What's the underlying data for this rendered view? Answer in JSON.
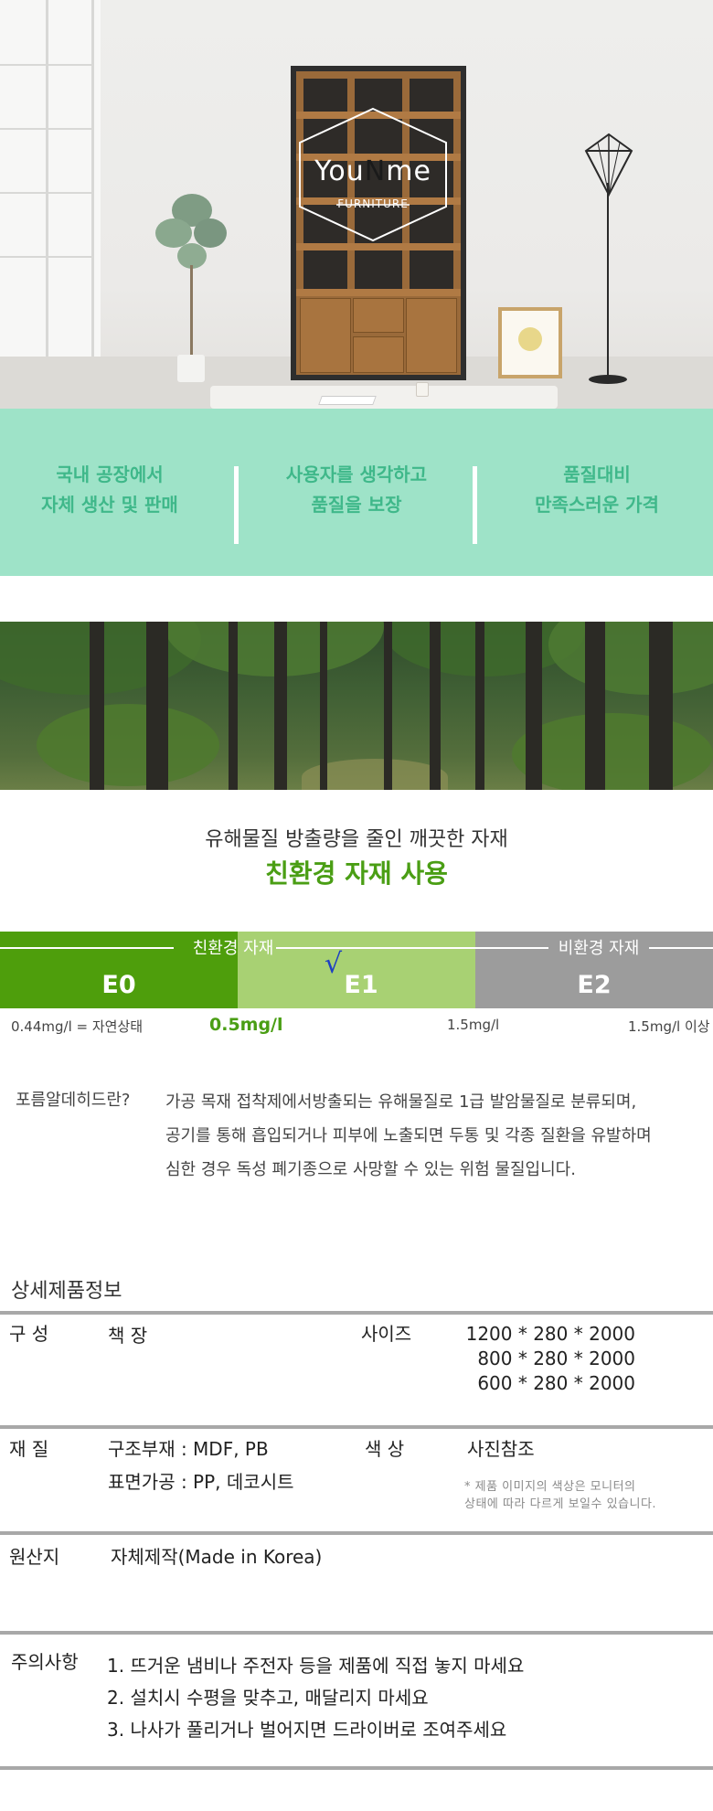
{
  "hero": {
    "brand_pre": "You",
    "brand_n": "N",
    "brand_post": "me",
    "brand_sub": "FURNITURE"
  },
  "features": [
    {
      "line1": "국내 공장에서",
      "line2": "자체 생산 및 판매"
    },
    {
      "line1": "사용자를 생각하고",
      "line2": "품질을 보장"
    },
    {
      "line1": "품질대비",
      "line2": "만족스러운 가격"
    }
  ],
  "eco": {
    "subtitle": "유해물질 방출량을 줄인 깨끗한 자재",
    "title": "친환경 자재 사용",
    "group_eco": "친환경 자재",
    "group_non_eco": "비환경 자재",
    "levels": [
      "E0",
      "E1",
      "E2"
    ],
    "selected_level": "E1",
    "check_mark": "√",
    "values": {
      "e0": "0.44mg/l = 자연상태",
      "e1": "0.5mg/l",
      "e2": "1.5mg/l",
      "e2_plus": "1.5mg/l 이상"
    },
    "formal_label": "포름알데히드란?",
    "formal_lines": [
      "가공 목재 접착제에서방출되는 유해물질로 1급 발암물질로 분류되며,",
      "공기를 통해 흡입되거나 피부에 노출되면 두통 및 각종 질환을 유발하며",
      "심한 경우 독성 폐기종으로 사망할 수 있는 위험 물질입니다."
    ]
  },
  "detail": {
    "title": "상세제품정보",
    "composition_label": "구 성",
    "composition_value": "책 장",
    "size_label": "사이즈",
    "sizes": [
      "1200 * 280 * 2000",
      "800 * 280 * 2000",
      "600 * 280 * 2000"
    ],
    "material_label": "재 질",
    "material_values": [
      "구조부재 : MDF, PB",
      "표면가공 : PP, 데코시트"
    ],
    "color_label": "색 상",
    "color_value": "사진참조",
    "color_note": [
      "* 제품 이미지의 색상은 모니터의",
      "상태에 따라 다르게 보일수 있습니다."
    ],
    "origin_label": "원산지",
    "origin_value": "자체제작(Made in Korea)",
    "caution_label": "주의사항",
    "cautions": [
      "1. 뜨거운 냄비나 주전자 등을 제품에 직접 놓지 마세요",
      "2. 설치시 수평을 맞추고, 매달리지 마세요",
      "3. 나사가 풀리거나 벌어지면 드라이버로 조여주세요"
    ]
  }
}
